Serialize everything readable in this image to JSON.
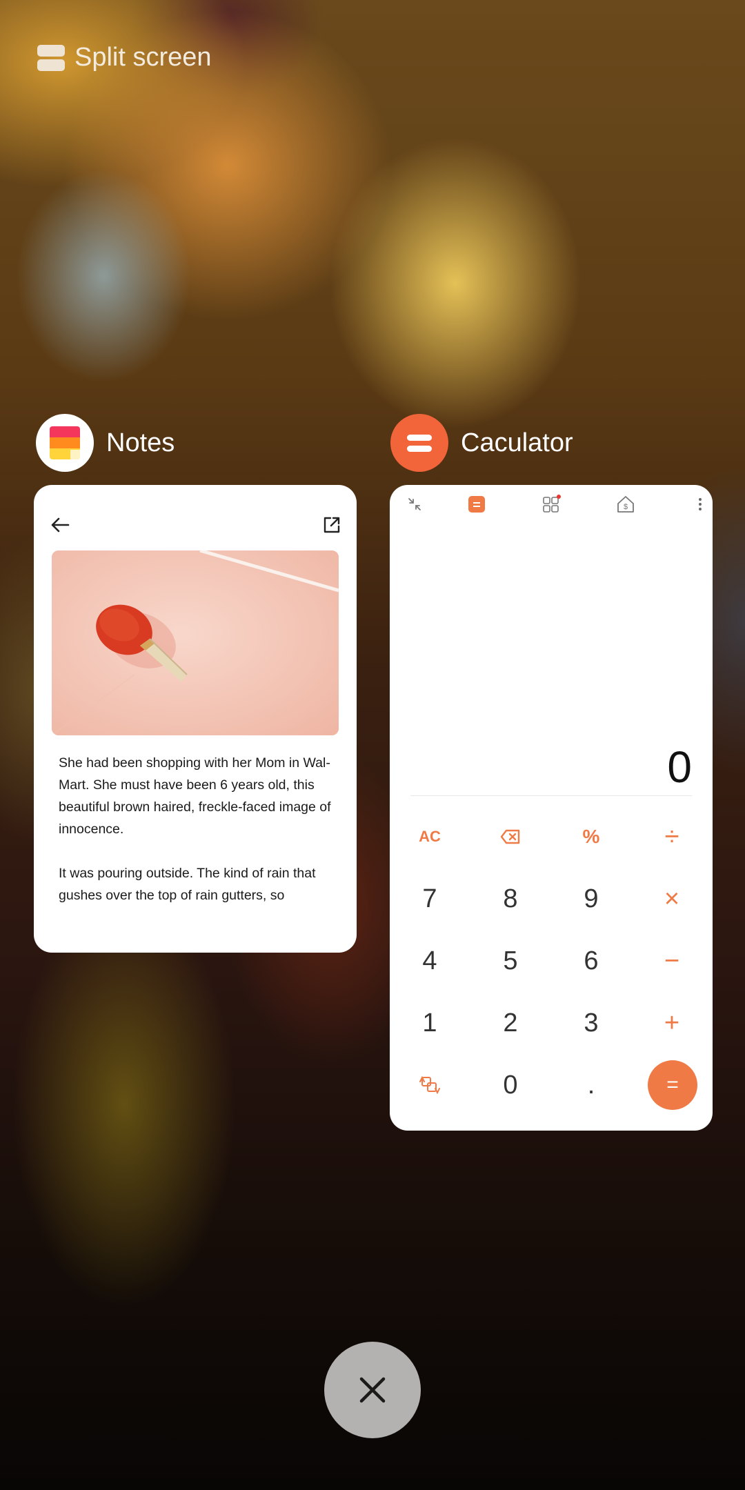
{
  "split_screen": {
    "label": "Split screen",
    "icon": "split-screen-icon"
  },
  "apps": {
    "notes": {
      "name": "Notes",
      "icon": "notes-app-icon",
      "image": "table-tennis-paddle-photo",
      "body": [
        "She had been shopping with her Mom in Wal-Mart. She must have been 6 years old, this beautiful brown haired, freckle-faced image of innocence.",
        "It was pouring outside. The kind of rain that gushes over the top of rain gutters, so"
      ]
    },
    "calculator": {
      "name": "Caculator",
      "icon": "calculator-app-icon",
      "display": "0",
      "keys": {
        "ac": "AC",
        "backspace": "⌫",
        "percent": "%",
        "divide": "÷",
        "k7": "7",
        "k8": "8",
        "k9": "9",
        "multiply": "×",
        "k4": "4",
        "k5": "5",
        "k6": "6",
        "minus": "−",
        "k1": "1",
        "k2": "2",
        "k3": "3",
        "plus": "+",
        "k0": "0",
        "dot": ".",
        "equals": "="
      }
    }
  },
  "colors": {
    "accent": "#ef7a46",
    "calc_icon": "#f2643a"
  }
}
